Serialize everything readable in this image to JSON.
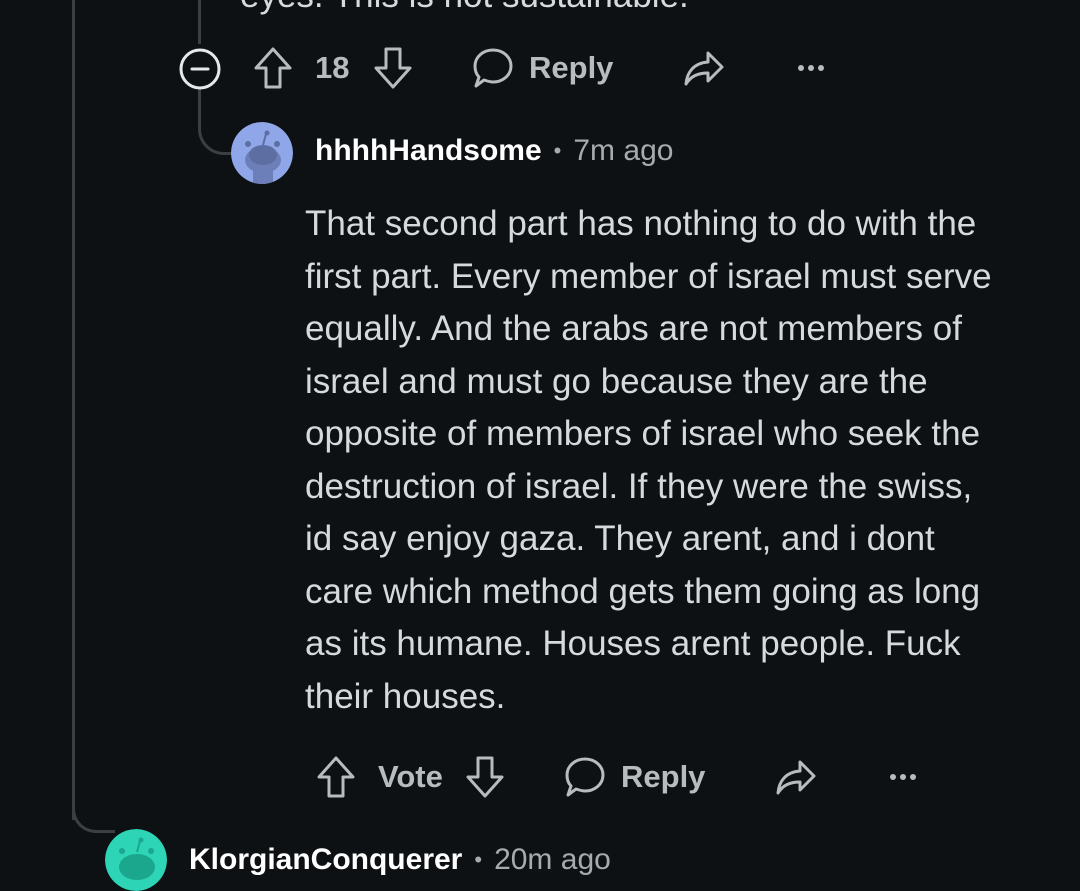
{
  "parent_comment": {
    "truncated_text": "eyes. This is not sustainable.",
    "vote_count": "18",
    "reply_label": "Reply"
  },
  "reply_comment": {
    "username": "hhhhHandsome",
    "separator": "•",
    "timestamp": "7m ago",
    "body_lines": [
      "That second part has nothing to do with the",
      "first part. Every member of israel must serve",
      "equally. And the arabs are not members of",
      "israel and must go because they are the",
      "opposite of members of israel who seek the",
      "destruction of israel. If they were the swiss,",
      "id say enjoy gaza. They arent, and i dont",
      "care which method gets them going as long",
      "as its humane. Houses arent people. Fuck",
      "their houses."
    ],
    "vote_label": "Vote",
    "reply_label": "Reply",
    "avatar_color": "#8fa7e8"
  },
  "next_comment": {
    "username": "KlorgianConquerer",
    "separator": "•",
    "timestamp": "20m ago",
    "avatar_color": "#2dd4b5"
  },
  "icons": {
    "collapse": "collapse-icon",
    "upvote": "upvote-arrow-icon",
    "downvote": "downvote-arrow-icon",
    "reply": "reply-bubble-icon",
    "share": "share-arrow-icon",
    "more": "more-options-icon"
  }
}
